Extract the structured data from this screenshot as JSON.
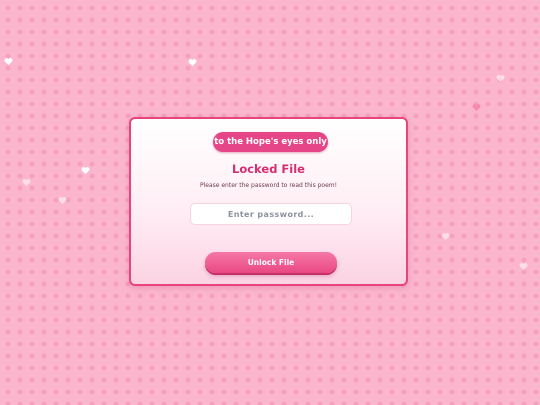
{
  "dialog": {
    "badge_label": "to the Hope's eyes only",
    "title": "Locked File",
    "subtitle": "Please enter the password to read this poem!",
    "password_input": {
      "value": "",
      "placeholder": "Enter password..."
    },
    "unlock_label": "Unlock File"
  },
  "decorations": {
    "icon": "heart-icon"
  },
  "colors": {
    "background": "#fbb6cd",
    "polka_dot": "#ec78a0",
    "accent": "#e64687",
    "title": "#d62e72",
    "subtitle": "#6b3a4e",
    "border": "#e8457f"
  }
}
